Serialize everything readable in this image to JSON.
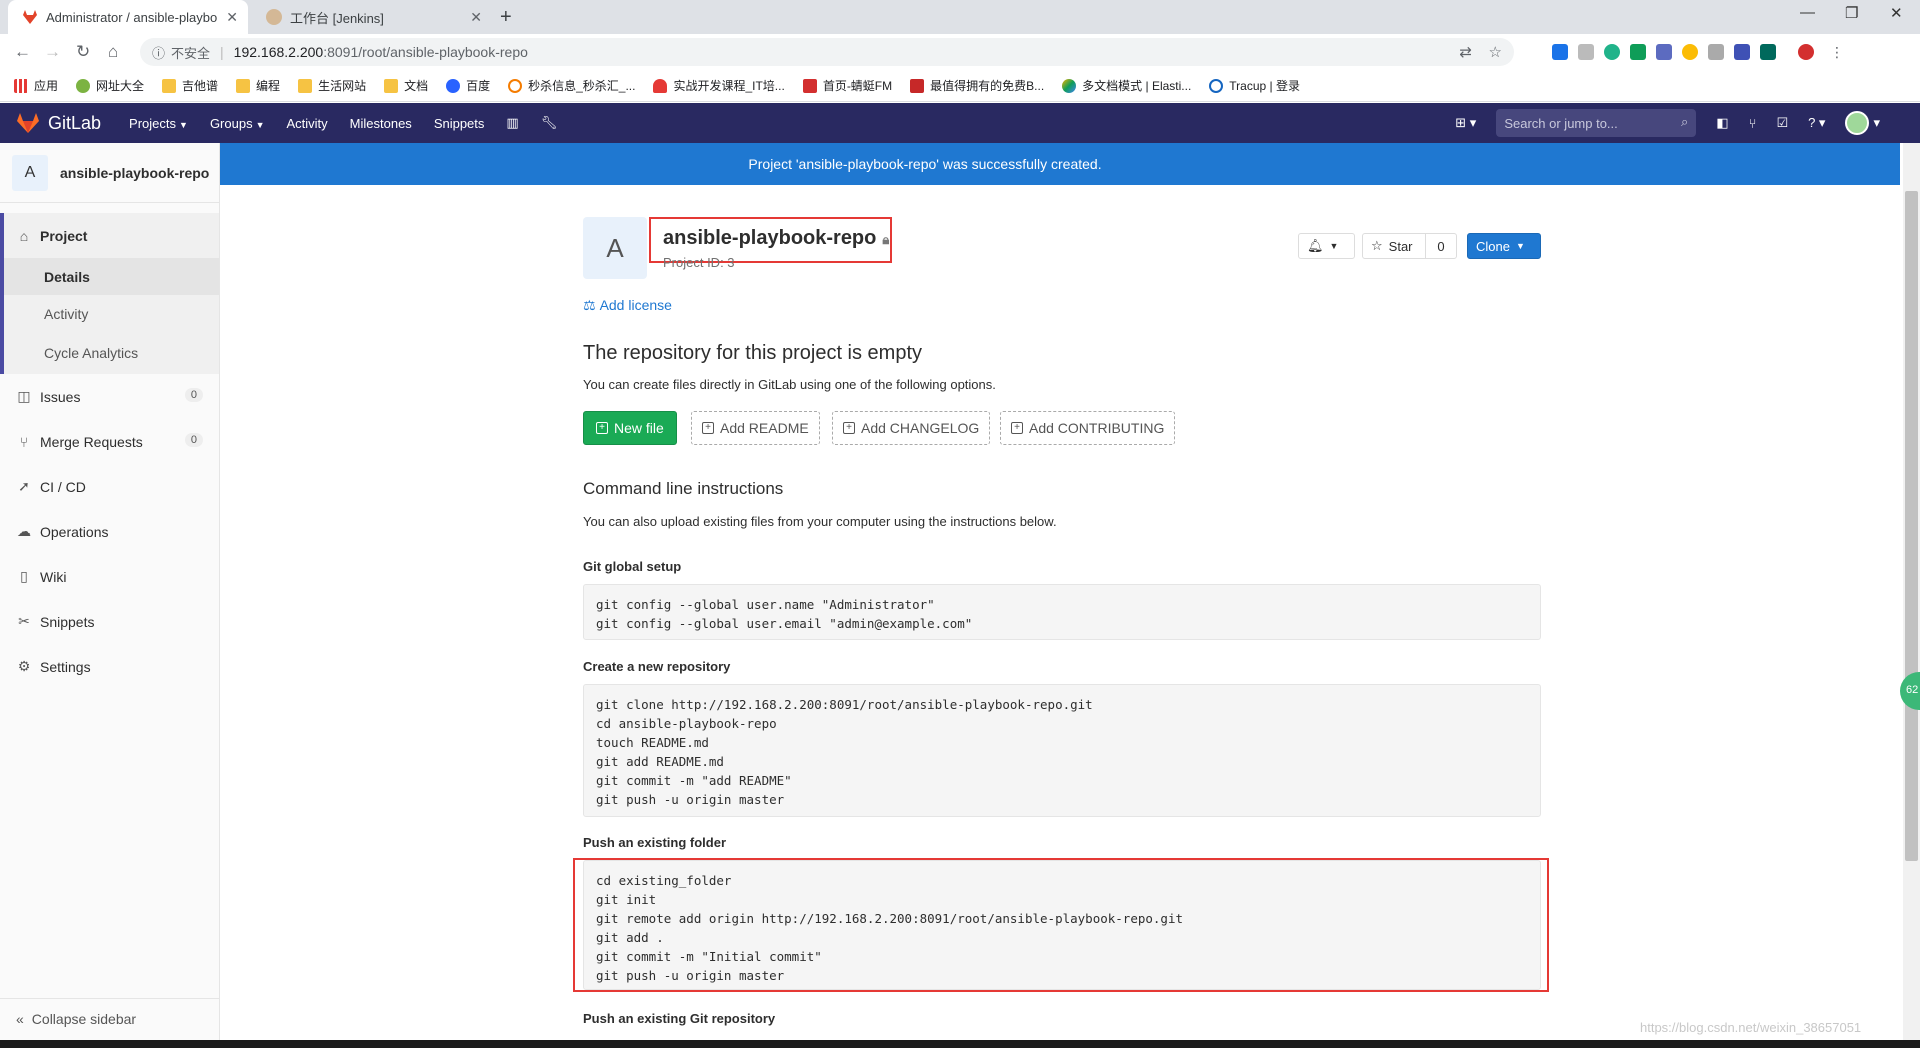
{
  "browser": {
    "tabs": [
      {
        "title": "Administrator / ansible-playbo",
        "active": true
      },
      {
        "title": "工作台 [Jenkins]",
        "active": false
      }
    ],
    "address": {
      "security": "不安全",
      "host": "192.168.2.200",
      "path": ":8091/root/ansible-playbook-repo"
    },
    "bookmarks": [
      "应用",
      "网址大全",
      "吉他谱",
      "编程",
      "生活网站",
      "文档",
      "百度",
      "秒杀信息_秒杀汇_...",
      "实战开发课程_IT培...",
      "首页-蜻蜓FM",
      "最值得拥有的免费B...",
      "多文档模式 | Elasti...",
      "Tracup | 登录"
    ]
  },
  "header": {
    "brand": "GitLab",
    "nav": [
      "Projects",
      "Groups",
      "Activity",
      "Milestones",
      "Snippets"
    ],
    "search_placeholder": "Search or jump to..."
  },
  "sidebar": {
    "project_initial": "A",
    "project_name": "ansible-playbook-repo",
    "project_label": "Project",
    "subitems": [
      "Details",
      "Activity",
      "Cycle Analytics"
    ],
    "issues": {
      "label": "Issues",
      "count": "0"
    },
    "merge_requests": {
      "label": "Merge Requests",
      "count": "0"
    },
    "items": [
      "CI / CD",
      "Operations",
      "Wiki",
      "Snippets",
      "Settings"
    ],
    "collapse": "Collapse sidebar"
  },
  "flash": "Project 'ansible-playbook-repo' was successfully created.",
  "project": {
    "initial": "A",
    "title": "ansible-playbook-repo",
    "id_text": "Project ID: 3",
    "star_label": "Star",
    "star_count": "0",
    "clone_label": "Clone",
    "add_license": "Add license"
  },
  "empty": {
    "heading": "The repository for this project is empty",
    "text": "You can create files directly in GitLab using one of the following options.",
    "new_file": "New file",
    "add_readme": "Add README",
    "add_changelog": "Add CHANGELOG",
    "add_contributing": "Add CONTRIBUTING"
  },
  "cli": {
    "heading": "Command line instructions",
    "text": "You can also upload existing files from your computer using the instructions below.",
    "global_setup_h": "Git global setup",
    "global_setup_code": "git config --global user.name \"Administrator\"\ngit config --global user.email \"admin@example.com\"",
    "new_repo_h": "Create a new repository",
    "new_repo_code": "git clone http://192.168.2.200:8091/root/ansible-playbook-repo.git\ncd ansible-playbook-repo\ntouch README.md\ngit add README.md\ngit commit -m \"add README\"\ngit push -u origin master",
    "existing_folder_h": "Push an existing folder",
    "existing_folder_code": "cd existing_folder\ngit init\ngit remote add origin http://192.168.2.200:8091/root/ansible-playbook-repo.git\ngit add .\ngit commit -m \"Initial commit\"\ngit push -u origin master",
    "existing_repo_h": "Push an existing Git repository"
  },
  "watermark": "https://blog.csdn.net/weixin_38657051",
  "float_badge": "62",
  "colors": {
    "header": "#292961",
    "accent": "#1f78d1",
    "success": "#1aaa55",
    "highlight": "#e53935"
  }
}
